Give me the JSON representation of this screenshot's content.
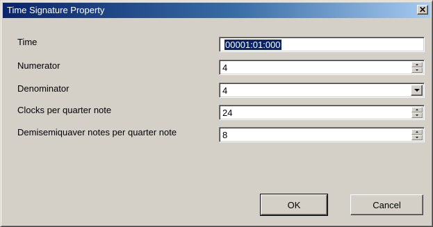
{
  "window": {
    "title": "Time Signature Property",
    "close_glyph": "✕"
  },
  "fields": {
    "time": {
      "label": "Time",
      "value": "00001:01:000"
    },
    "numerator": {
      "label": "Numerator",
      "value": "4"
    },
    "denominator": {
      "label": "Denominator",
      "value": "4"
    },
    "clocks": {
      "label": "Clocks per quarter note",
      "value": "24"
    },
    "demisemiquaver": {
      "label": "Demisemiquaver notes per quarter note",
      "value": "8"
    }
  },
  "buttons": {
    "ok": "OK",
    "cancel": "Cancel"
  },
  "colors": {
    "titlebar_start": "#0a246a",
    "titlebar_end": "#a6caf0",
    "face": "#d4d0c8",
    "selection": "#0a246a"
  }
}
